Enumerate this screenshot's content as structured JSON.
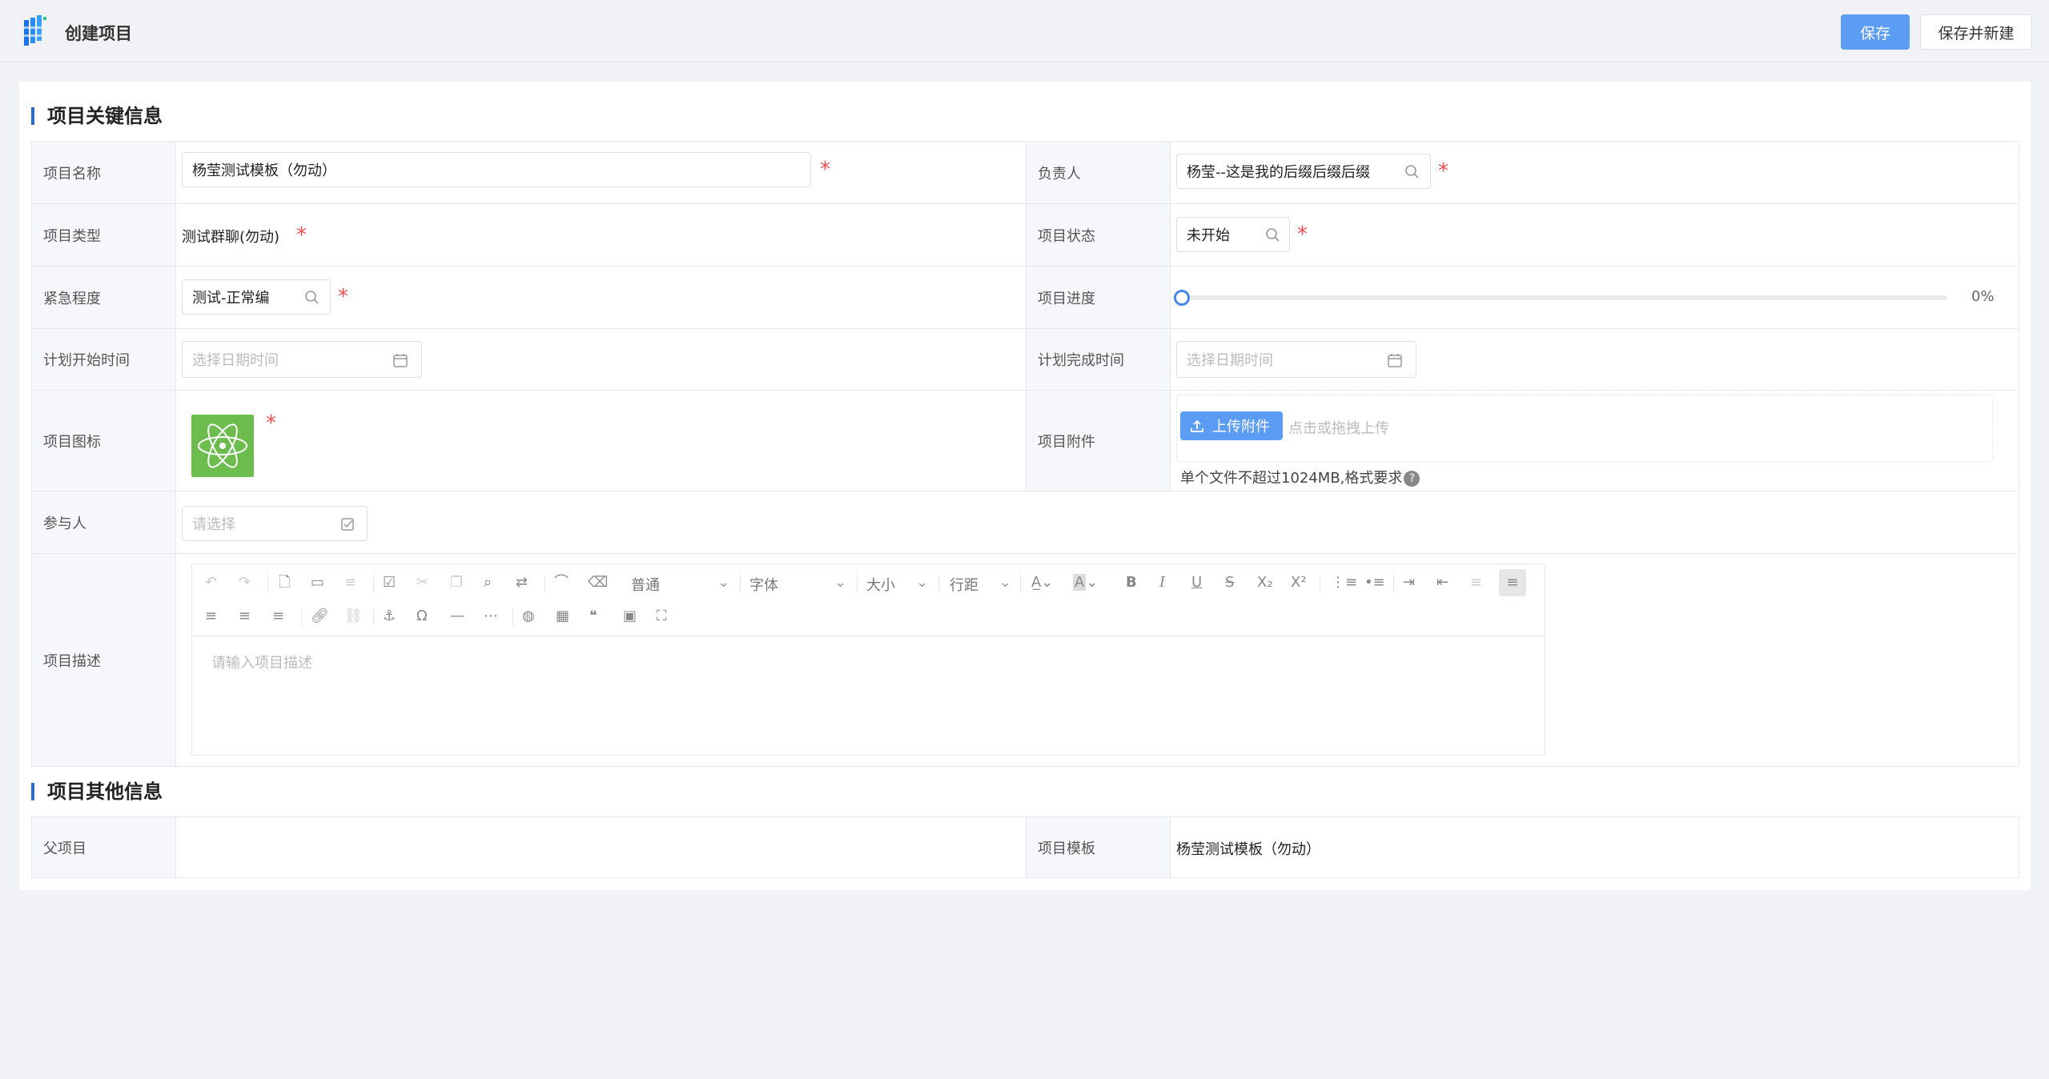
{
  "header": {
    "title": "创建项目",
    "save_label": "保存",
    "save_new_label": "保存并新建"
  },
  "section_key": {
    "title": "项目关键信息"
  },
  "section_other": {
    "title": "项目其他信息"
  },
  "fields": {
    "name": {
      "label": "项目名称",
      "value": "杨莹测试模板（勿动）"
    },
    "owner": {
      "label": "负责人",
      "value": "杨莹--这是我的后缀后缀后缀"
    },
    "type": {
      "label": "项目类型",
      "value": "测试群聊(勿动)"
    },
    "status": {
      "label": "项目状态",
      "value": "未开始"
    },
    "urgency": {
      "label": "紧急程度",
      "value": "测试-正常编"
    },
    "progress": {
      "label": "项目进度",
      "value": 0,
      "text": "0%"
    },
    "plan_start": {
      "label": "计划开始时间",
      "placeholder": "选择日期时间"
    },
    "plan_end": {
      "label": "计划完成时间",
      "placeholder": "选择日期时间"
    },
    "icon": {
      "label": "项目图标"
    },
    "attachment": {
      "label": "项目附件",
      "button": "上传附件",
      "drop_hint": "点击或拖拽上传",
      "limit": "单个文件不超过1024MB,格式要求"
    },
    "participants": {
      "label": "参与人",
      "placeholder": "请选择"
    },
    "description": {
      "label": "项目描述",
      "placeholder": "请输入项目描述"
    },
    "parent": {
      "label": "父项目",
      "value": ""
    },
    "template": {
      "label": "项目模板",
      "value": "杨莹测试模板（勿动）"
    }
  },
  "editor": {
    "paragraph": "普通",
    "font": "字体",
    "size": "大小",
    "line_height": "行距"
  },
  "colors": {
    "primary": "#5b9cf5",
    "required": "#f04e4e",
    "icon_bg": "#6cbd4e",
    "accent_bar": "#2a6bd6"
  }
}
